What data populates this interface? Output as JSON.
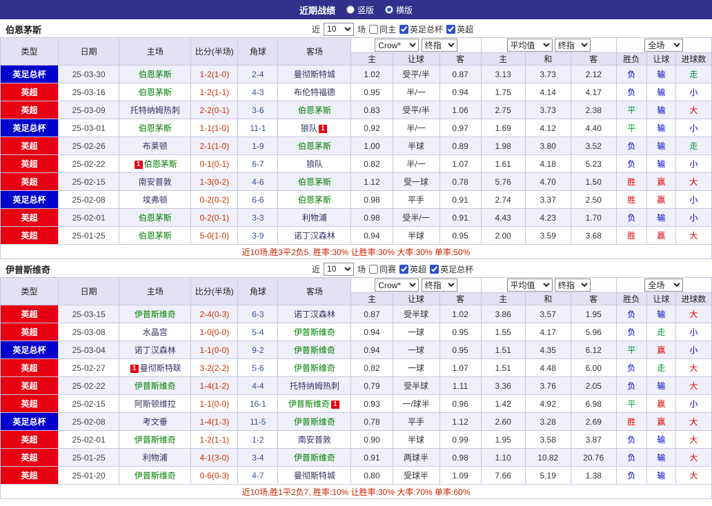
{
  "topbar": {
    "title": "近期战绩",
    "options": [
      {
        "label": "竖版",
        "selected": false
      },
      {
        "label": "横版",
        "selected": true
      }
    ]
  },
  "labels": {
    "near": "近",
    "matches": "场"
  },
  "controls": {
    "company": "Crow*",
    "final_odds_1": "终指",
    "average": "平均值",
    "final_odds_2": "终指",
    "scope": "全场"
  },
  "columns": [
    "类型",
    "日期",
    "主场",
    "比分(半场)",
    "角球",
    "客场",
    "主",
    "让球",
    "客",
    "主",
    "和",
    "客",
    "胜负",
    "让球",
    "进球数"
  ],
  "colors": {
    "topbar_bg": "#31318c",
    "header_bg": "#e2e2f2",
    "row_alt_bg": "#efeff9",
    "league_epl": "#e60012",
    "league_facup": "#0000cc",
    "team_focal": "#008000",
    "team_other": "#333366",
    "score": "#cc3300",
    "corners": "#33519c",
    "win_red": "#e60000",
    "loss_blue": "#0000dd",
    "draw_green": "#009933",
    "summary_text": "#cc2200"
  },
  "sections": [
    {
      "team": "伯恩茅斯",
      "count": "10",
      "filters": [
        {
          "label": "同主",
          "checked": false
        },
        {
          "label": "英足总杯",
          "checked": true
        },
        {
          "label": "英超",
          "checked": true
        }
      ],
      "rows": [
        {
          "league": "英足总杯",
          "date": "25-03-30",
          "home": "伯恩茅斯",
          "score": "1-2(1-0)",
          "corners": "2-4",
          "away": "曼彻斯特城",
          "h_odds": "1.02",
          "line": "受平/半",
          "a_odds": "0.87",
          "e_home": "3.13",
          "e_draw": "3.73",
          "e_away": "2.12",
          "res": "负",
          "h_res": "输",
          "g_res": "走"
        },
        {
          "league": "英超",
          "date": "25-03-16",
          "home": "伯恩茅斯",
          "score": "1-2(1-1)",
          "corners": "4-3",
          "away": "布伦特福德",
          "h_odds": "0.95",
          "line": "半/一",
          "a_odds": "0.94",
          "e_home": "1.75",
          "e_draw": "4.14",
          "e_away": "4.17",
          "res": "负",
          "h_res": "输",
          "g_res": "小"
        },
        {
          "league": "英超",
          "date": "25-03-09",
          "home": "托特纳姆热刺",
          "score": "2-2(0-1)",
          "corners": "3-6",
          "away": "伯恩茅斯",
          "h_odds": "0.83",
          "line": "受平/半",
          "a_odds": "1.06",
          "e_home": "2.75",
          "e_draw": "3.73",
          "e_away": "2.38",
          "res": "平",
          "h_res": "输",
          "g_res": "大"
        },
        {
          "league": "英足总杯",
          "date": "25-03-01",
          "home": "伯恩茅斯",
          "score": "1-1(1-0)",
          "corners": "11-1",
          "away": "狼队",
          "away_red": 1,
          "h_odds": "0.92",
          "line": "半/一",
          "a_odds": "0.97",
          "e_home": "1.69",
          "e_draw": "4.12",
          "e_away": "4.40",
          "res": "平",
          "h_res": "输",
          "g_res": "小"
        },
        {
          "league": "英超",
          "date": "25-02-26",
          "home": "布莱顿",
          "score": "2-1(1-0)",
          "corners": "1-9",
          "away": "伯恩茅斯",
          "h_odds": "1.00",
          "line": "半球",
          "a_odds": "0.89",
          "e_home": "1.98",
          "e_draw": "3.80",
          "e_away": "3.52",
          "res": "负",
          "h_res": "输",
          "g_res": "走"
        },
        {
          "league": "英超",
          "date": "25-02-22",
          "home": "伯恩茅斯",
          "home_red": 1,
          "score": "0-1(0-1)",
          "corners": "6-7",
          "away": "狼队",
          "h_odds": "0.82",
          "line": "半/一",
          "a_odds": "1.07",
          "e_home": "1.61",
          "e_draw": "4.18",
          "e_away": "5.23",
          "res": "负",
          "h_res": "输",
          "g_res": "小"
        },
        {
          "league": "英超",
          "date": "25-02-15",
          "home": "南安普敦",
          "score": "1-3(0-2)",
          "corners": "4-6",
          "away": "伯恩茅斯",
          "h_odds": "1.12",
          "line": "受一球",
          "a_odds": "0.78",
          "e_home": "5.76",
          "e_draw": "4.70",
          "e_away": "1.50",
          "res": "胜",
          "h_res": "赢",
          "g_res": "大"
        },
        {
          "league": "英足总杯",
          "date": "25-02-08",
          "home": "埃弗顿",
          "score": "0-2(0-2)",
          "corners": "6-6",
          "away": "伯恩茅斯",
          "h_odds": "0.98",
          "line": "平手",
          "a_odds": "0.91",
          "e_home": "2.74",
          "e_draw": "3.37",
          "e_away": "2.50",
          "res": "胜",
          "h_res": "赢",
          "g_res": "小"
        },
        {
          "league": "英超",
          "date": "25-02-01",
          "home": "伯恩茅斯",
          "score": "0-2(0-1)",
          "corners": "3-3",
          "away": "利物浦",
          "h_odds": "0.98",
          "line": "受半/一",
          "a_odds": "0.91",
          "e_home": "4.43",
          "e_draw": "4.23",
          "e_away": "1.70",
          "res": "负",
          "h_res": "输",
          "g_res": "小"
        },
        {
          "league": "英超",
          "date": "25-01-25",
          "home": "伯恩茅斯",
          "score": "5-0(1-0)",
          "corners": "3-9",
          "away": "诺丁汉森林",
          "h_odds": "0.94",
          "line": "半球",
          "a_odds": "0.95",
          "e_home": "2.00",
          "e_draw": "3.59",
          "e_away": "3.68",
          "res": "胜",
          "h_res": "赢",
          "g_res": "大"
        }
      ],
      "summary": "近10场,胜3平2负5, 胜率:30% 让胜率:30% 大率:30% 单率:50%"
    },
    {
      "team": "伊普斯维奇",
      "count": "10",
      "filters": [
        {
          "label": "同赛",
          "checked": false
        },
        {
          "label": "英超",
          "checked": true
        },
        {
          "label": "英足总杯",
          "checked": true
        }
      ],
      "rows": [
        {
          "league": "英超",
          "date": "25-03-15",
          "home": "伊普斯维奇",
          "score": "2-4(0-3)",
          "corners": "6-3",
          "away": "诺丁汉森林",
          "h_odds": "0.87",
          "line": "受半球",
          "a_odds": "1.02",
          "e_home": "3.86",
          "e_draw": "3.57",
          "e_away": "1.95",
          "res": "负",
          "h_res": "输",
          "g_res": "大"
        },
        {
          "league": "英超",
          "date": "25-03-08",
          "home": "水晶宫",
          "score": "1-0(0-0)",
          "corners": "5-4",
          "away": "伊普斯维奇",
          "h_odds": "0.94",
          "line": "一球",
          "a_odds": "0.95",
          "e_home": "1.55",
          "e_draw": "4.17",
          "e_away": "5.96",
          "res": "负",
          "h_res": "走",
          "g_res": "小"
        },
        {
          "league": "英足总杯",
          "date": "25-03-04",
          "home": "诺丁汉森林",
          "score": "1-1(0-0)",
          "corners": "9-2",
          "away": "伊普斯维奇",
          "h_odds": "0.94",
          "line": "一球",
          "a_odds": "0.95",
          "e_home": "1.51",
          "e_draw": "4.35",
          "e_away": "6.12",
          "res": "平",
          "h_res": "赢",
          "g_res": "小"
        },
        {
          "league": "英超",
          "date": "25-02-27",
          "home": "曼彻斯特联",
          "home_red": 1,
          "score": "3-2(2-2)",
          "corners": "5-6",
          "away": "伊普斯维奇",
          "h_odds": "0.82",
          "line": "一球",
          "a_odds": "1.07",
          "e_home": "1.51",
          "e_draw": "4.48",
          "e_away": "6.00",
          "res": "负",
          "h_res": "走",
          "g_res": "大"
        },
        {
          "league": "英超",
          "date": "25-02-22",
          "home": "伊普斯维奇",
          "score": "1-4(1-2)",
          "corners": "4-4",
          "away": "托特纳姆热刺",
          "h_odds": "0.79",
          "line": "受半球",
          "a_odds": "1.11",
          "e_home": "3.36",
          "e_draw": "3.76",
          "e_away": "2.05",
          "res": "负",
          "h_res": "输",
          "g_res": "大"
        },
        {
          "league": "英超",
          "date": "25-02-15",
          "home": "阿斯顿维拉",
          "score": "1-1(0-0)",
          "corners": "16-1",
          "away": "伊普斯维奇",
          "away_red": 1,
          "h_odds": "0.93",
          "line": "一/球半",
          "a_odds": "0.96",
          "e_home": "1.42",
          "e_draw": "4.92",
          "e_away": "6.98",
          "res": "平",
          "h_res": "赢",
          "g_res": "小"
        },
        {
          "league": "英足总杯",
          "date": "25-02-08",
          "home": "考文垂",
          "score": "1-4(1-3)",
          "corners": "11-5",
          "away": "伊普斯维奇",
          "h_odds": "0.78",
          "line": "平手",
          "a_odds": "1.12",
          "e_home": "2.60",
          "e_draw": "3.28",
          "e_away": "2.69",
          "res": "胜",
          "h_res": "赢",
          "g_res": "大"
        },
        {
          "league": "英超",
          "date": "25-02-01",
          "home": "伊普斯维奇",
          "score": "1-2(1-1)",
          "corners": "1-2",
          "away": "南安普敦",
          "h_odds": "0.90",
          "line": "半球",
          "a_odds": "0.99",
          "e_home": "1.95",
          "e_draw": "3.58",
          "e_away": "3.87",
          "res": "负",
          "h_res": "输",
          "g_res": "大"
        },
        {
          "league": "英超",
          "date": "25-01-25",
          "home": "利物浦",
          "score": "4-1(3-0)",
          "corners": "3-4",
          "away": "伊普斯维奇",
          "h_odds": "0.91",
          "line": "两球半",
          "a_odds": "0.98",
          "e_home": "1.10",
          "e_draw": "10.82",
          "e_away": "20.76",
          "res": "负",
          "h_res": "输",
          "g_res": "大"
        },
        {
          "league": "英超",
          "date": "25-01-20",
          "home": "伊普斯维奇",
          "score": "0-6(0-3)",
          "corners": "4-7",
          "away": "曼彻斯特城",
          "h_odds": "0.80",
          "line": "受球半",
          "a_odds": "1.09",
          "e_home": "7.66",
          "e_draw": "5.19",
          "e_away": "1.38",
          "res": "负",
          "h_res": "输",
          "g_res": "大"
        }
      ],
      "summary": "近10场,胜1平2负7, 胜率:10% 让胜率:30% 大率:70% 单率:60%"
    }
  ]
}
